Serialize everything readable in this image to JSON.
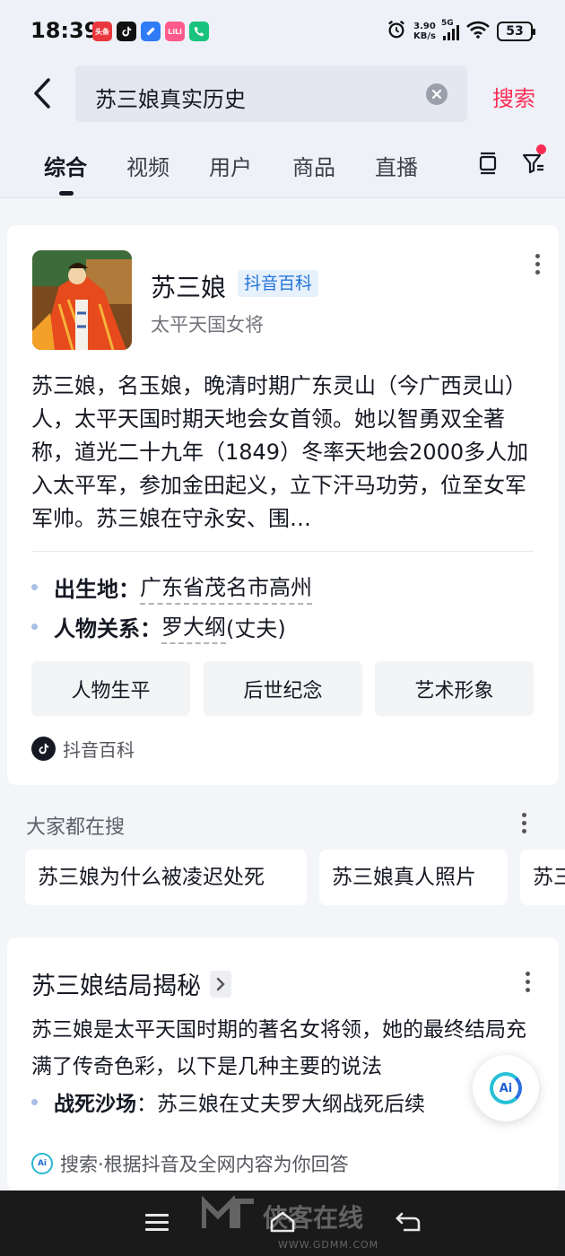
{
  "status_bar": {
    "time": "18:39",
    "apps": [
      {
        "name": "头条",
        "color": "#e8383d"
      },
      {
        "name": "",
        "color": "#111111"
      },
      {
        "name": "",
        "color": "#2f7cf6"
      },
      {
        "name": "LiLi",
        "color": "#ff5a8a"
      },
      {
        "name": "",
        "color": "#19c37d"
      }
    ],
    "net_speed_value": "3.90",
    "net_speed_unit": "KB/s",
    "network": "5G",
    "battery": "53"
  },
  "search": {
    "query": "苏三娘真实历史",
    "submit_label": "搜索"
  },
  "tabs": [
    "综合",
    "视频",
    "用户",
    "商品",
    "直播"
  ],
  "entity_card": {
    "name": "苏三娘",
    "tag": "抖音百科",
    "subtitle": "太平天国女将",
    "description": "苏三娘，名玉娘，晚清时期广东灵山（今广西灵山）人，太平天国时期天地会女首领。她以智勇双全著称，道光二十九年（1849）冬率天地会2000多人加入太平军，参加金田起义，立下汗马功劳，位至女军军帅。苏三娘在守永安、围…",
    "attributes": [
      {
        "key": "出生地：",
        "value": "广东省茂名市高州"
      },
      {
        "key": "人物关系：",
        "value": "罗大纲",
        "extra": "(丈夫)"
      }
    ],
    "buttons": [
      "人物生平",
      "后世纪念",
      "艺术形象"
    ],
    "source": "抖音百科"
  },
  "related_searches": {
    "title": "大家都在搜",
    "items": [
      "苏三娘为什么被凌迟处死",
      "苏三娘真人照片",
      "苏三"
    ]
  },
  "ai_card": {
    "title": "苏三娘结局揭秘",
    "paragraph": "苏三娘是太平天国时期的著名女将领，她的最终结局充满了传奇色彩，以下是几种主要的说法",
    "bullet_key": "战死沙场",
    "bullet_text": "：苏三娘在丈夫罗大纲战死后续",
    "footer": "搜索·根据抖音及全网内容为你回答"
  },
  "watermark": {
    "text": "侠客在线",
    "url": "WWW.GDMM.COM"
  },
  "colors": {
    "accent": "#fe2c55",
    "baike_blue": "#2574d6",
    "page_bg": "#f4f5f9",
    "header_bg": "#eef1f8"
  }
}
